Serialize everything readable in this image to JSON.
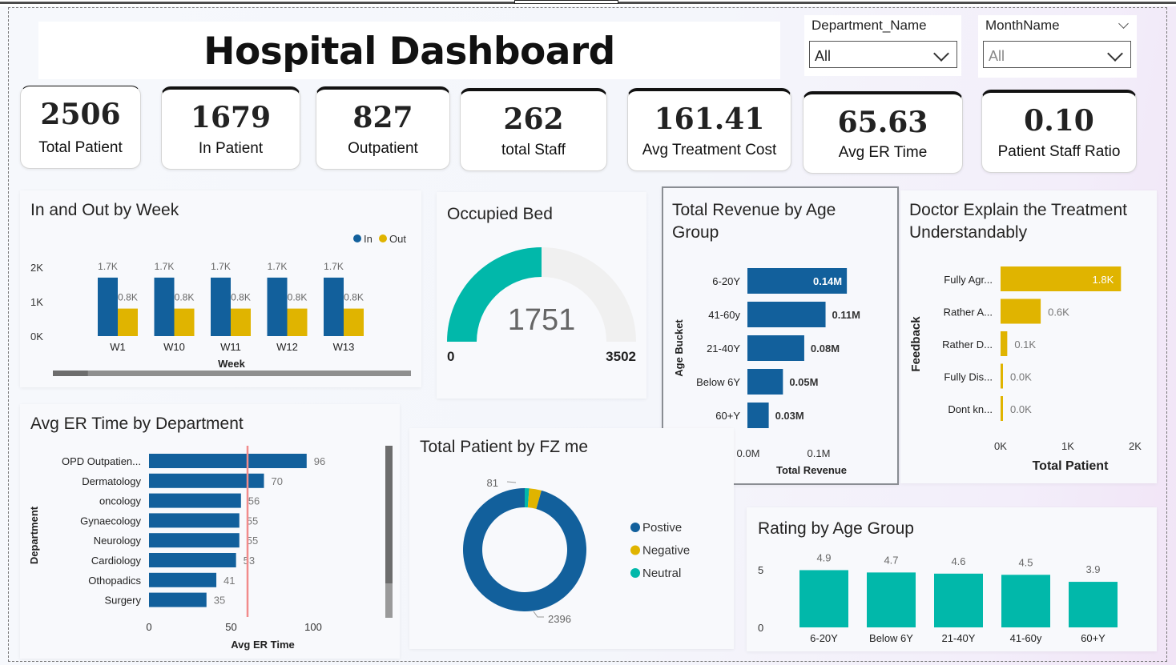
{
  "title": "Hospital Dashboard",
  "slicers": [
    {
      "label": "Department_Name",
      "value": "All"
    },
    {
      "label": "MonthName",
      "value": "All"
    }
  ],
  "kpis": [
    {
      "value": "2506",
      "label": "Total Patient"
    },
    {
      "value": "1679",
      "label": "In Patient"
    },
    {
      "value": "827",
      "label": "Outpatient"
    },
    {
      "value": "262",
      "label": "total Staff"
    },
    {
      "value": "161.41",
      "label": "Avg Treatment Cost"
    },
    {
      "value": "65.63",
      "label": "Avg ER Time"
    },
    {
      "value": "0.10",
      "label": "Patient Staff Ratio"
    }
  ],
  "colors": {
    "blue": "#12609c",
    "gold": "#e0b400",
    "teal": "#01b8aa",
    "gray": "#f0f0f0",
    "ref_line": "#f28b8b"
  },
  "chart_data": [
    {
      "id": "in_out_week",
      "type": "bar",
      "title": "In and Out by Week",
      "xlabel": "Week",
      "ylabel": "",
      "categories": [
        "W1",
        "W10",
        "W11",
        "W12",
        "W13"
      ],
      "series": [
        {
          "name": "In",
          "values": [
            1.7,
            1.7,
            1.7,
            1.7,
            1.7
          ],
          "labels": [
            "1.7K",
            "1.7K",
            "1.7K",
            "1.7K",
            "1.7K"
          ]
        },
        {
          "name": "Out",
          "values": [
            0.8,
            0.8,
            0.8,
            0.8,
            0.8
          ],
          "labels": [
            "0.8K",
            "0.8K",
            "0.8K",
            "0.8K",
            "0.8K"
          ]
        }
      ],
      "yticks": [
        "0K",
        "1K",
        "2K"
      ],
      "ylim": [
        0,
        2
      ],
      "legend": "top-right",
      "scroll_fraction": 0.1
    },
    {
      "id": "occupied_bed",
      "type": "gauge",
      "title": "Occupied Bed",
      "value": 1751,
      "value_label": "1751",
      "min": 0,
      "max": 3502,
      "min_label": "0",
      "max_label": "3502"
    },
    {
      "id": "revenue_age",
      "type": "bar",
      "orientation": "horizontal",
      "title": "Total Revenue by Age Group",
      "xlabel": "Total Revenue",
      "ylabel": "Age Bucket",
      "categories": [
        "6-20Y",
        "41-60y",
        "21-40Y",
        "Below 6Y",
        "60+Y"
      ],
      "values": [
        0.14,
        0.11,
        0.08,
        0.05,
        0.03
      ],
      "labels": [
        "0.14M",
        "0.11M",
        "0.08M",
        "0.05M",
        "0.03M"
      ],
      "xticks": [
        "0.0M",
        "0.1M"
      ],
      "xlim": [
        0,
        0.15
      ]
    },
    {
      "id": "doctor_explain",
      "type": "bar",
      "orientation": "horizontal",
      "title": "Doctor Explain the Treatment Understandably",
      "xlabel": "Total Patient",
      "ylabel": "Feedback",
      "categories": [
        "Fully Agr...",
        "Rather A...",
        "Rather D...",
        "Fully Dis...",
        "Dont kn..."
      ],
      "values": [
        1.8,
        0.6,
        0.1,
        0.0,
        0.0
      ],
      "labels": [
        "1.8K",
        "0.6K",
        "0.1K",
        "0.0K",
        "0.0K"
      ],
      "xticks": [
        "0K",
        "1K",
        "2K"
      ],
      "xlim": [
        0,
        2
      ]
    },
    {
      "id": "er_time_dept",
      "type": "bar",
      "orientation": "horizontal",
      "title": "Avg ER Time by Department",
      "xlabel": "Avg ER Time",
      "ylabel": "Department",
      "categories": [
        "OPD Outpatien...",
        "Dermatology",
        "oncology",
        "Gynaecology",
        "Neurology",
        "Cardiology",
        "Othopadics",
        "Surgery"
      ],
      "values": [
        96,
        70,
        56,
        55,
        55,
        53,
        41,
        35
      ],
      "labels": [
        "96",
        "70",
        "56",
        "55",
        "55",
        "53",
        "41",
        "35"
      ],
      "xticks": [
        "0",
        "50",
        "100"
      ],
      "xlim": [
        0,
        100
      ],
      "reference_line": 60
    },
    {
      "id": "patient_fz",
      "type": "pie",
      "title": "Total Patient by FZ me",
      "categories": [
        "Postive",
        "Negative",
        "Neutral"
      ],
      "values": [
        2396,
        81,
        29
      ],
      "data_labels": [
        "2396",
        "81"
      ],
      "legend": "right"
    },
    {
      "id": "rating_age",
      "type": "bar",
      "title": "Rating by Age Group",
      "categories": [
        "6-20Y",
        "Below 6Y",
        "21-40Y",
        "41-60y",
        "60+Y"
      ],
      "values": [
        4.9,
        4.7,
        4.6,
        4.5,
        3.9
      ],
      "labels": [
        "4.9",
        "4.7",
        "4.6",
        "4.5",
        "3.9"
      ],
      "yticks": [
        "0",
        "5"
      ],
      "ylim": [
        0,
        5
      ]
    }
  ]
}
